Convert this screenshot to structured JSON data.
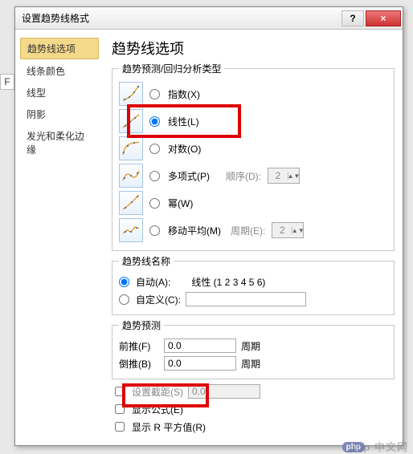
{
  "dialog": {
    "title": "设置趋势线格式",
    "help": "?",
    "close": "×"
  },
  "sidebar": {
    "items": [
      {
        "label": "趋势线选项",
        "active": true
      },
      {
        "label": "线条颜色"
      },
      {
        "label": "线型"
      },
      {
        "label": "阴影"
      },
      {
        "label": "发光和柔化边缘"
      }
    ]
  },
  "main": {
    "heading": "趋势线选项",
    "trend_group": "趋势预测/回归分析类型",
    "types": {
      "exponential": "指数(X)",
      "linear": "线性(L)",
      "logarithmic": "对数(O)",
      "polynomial": "多项式(P)",
      "power": "幂(W)",
      "moving_avg": "移动平均(M)"
    },
    "order_label": "顺序(D):",
    "order_value": "2",
    "period_label": "周期(E):",
    "period_value": "2",
    "name_group": "趋势线名称",
    "name_auto": "自动(A):",
    "name_auto_value": "线性 (1 2 3 4 5 6)",
    "name_custom": "自定义(C):",
    "forecast_group": "趋势预测",
    "forward_label": "前推(F)",
    "forward_value": "0.0",
    "backward_label": "倒推(B)",
    "backward_value": "0.0",
    "unit": "周期",
    "set_intercept": "设置截距(S)",
    "intercept_value": "0.0",
    "show_equation": "显示公式(E)",
    "show_r2": "显示 R 平方值(R)"
  },
  "left_letter": "F",
  "watermark": "php 中文网"
}
